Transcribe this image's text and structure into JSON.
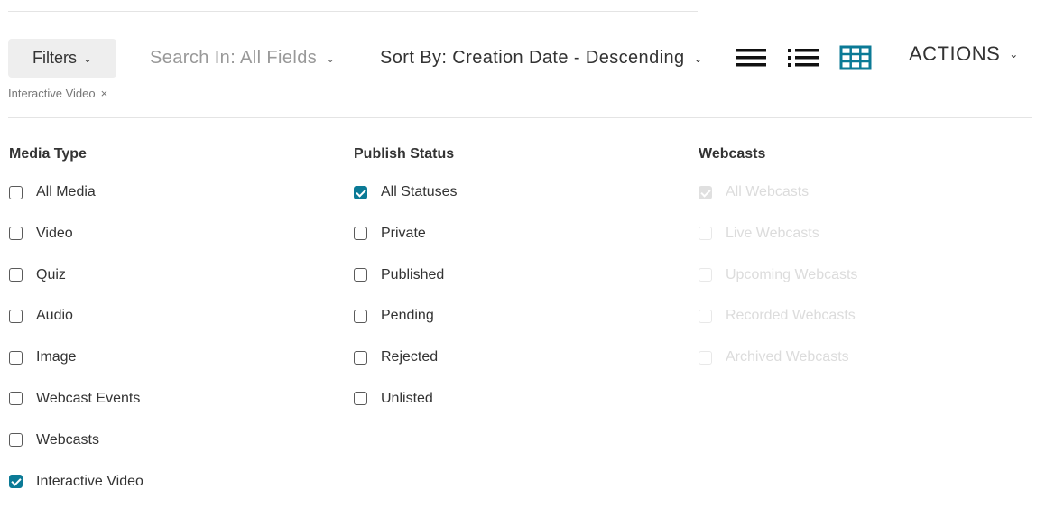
{
  "toolbar": {
    "filters_label": "Filters",
    "search_in_label": "Search In: All Fields",
    "sort_by_label": "Sort By: Creation Date - Descending",
    "actions_label": "ACTIONS",
    "chevron_icon": "chevron-down-icon",
    "view_icons": [
      "list-view-icon",
      "detail-view-icon",
      "grid-view-icon"
    ],
    "active_view": "grid-view",
    "accent_color": "#0b7a96"
  },
  "active_filter": {
    "label": "Interactive Video",
    "remove_glyph": "×"
  },
  "media_type": {
    "title": "Media Type",
    "options": [
      {
        "label": "All Media",
        "checked": false
      },
      {
        "label": "Video",
        "checked": false
      },
      {
        "label": "Quiz",
        "checked": false
      },
      {
        "label": "Audio",
        "checked": false
      },
      {
        "label": "Image",
        "checked": false
      },
      {
        "label": "Webcast Events",
        "checked": false
      },
      {
        "label": "Webcasts",
        "checked": false
      },
      {
        "label": "Interactive Video",
        "checked": true
      }
    ]
  },
  "publish_status": {
    "title": "Publish Status",
    "options": [
      {
        "label": "All Statuses",
        "checked": true
      },
      {
        "label": "Private",
        "checked": false
      },
      {
        "label": "Published",
        "checked": false
      },
      {
        "label": "Pending",
        "checked": false
      },
      {
        "label": "Rejected",
        "checked": false
      },
      {
        "label": "Unlisted",
        "checked": false
      }
    ]
  },
  "webcasts": {
    "title": "Webcasts",
    "disabled": true,
    "options": [
      {
        "label": "All Webcasts",
        "checked": true
      },
      {
        "label": "Live Webcasts",
        "checked": false
      },
      {
        "label": "Upcoming Webcasts",
        "checked": false
      },
      {
        "label": "Recorded Webcasts",
        "checked": false
      },
      {
        "label": "Archived Webcasts",
        "checked": false
      }
    ]
  }
}
